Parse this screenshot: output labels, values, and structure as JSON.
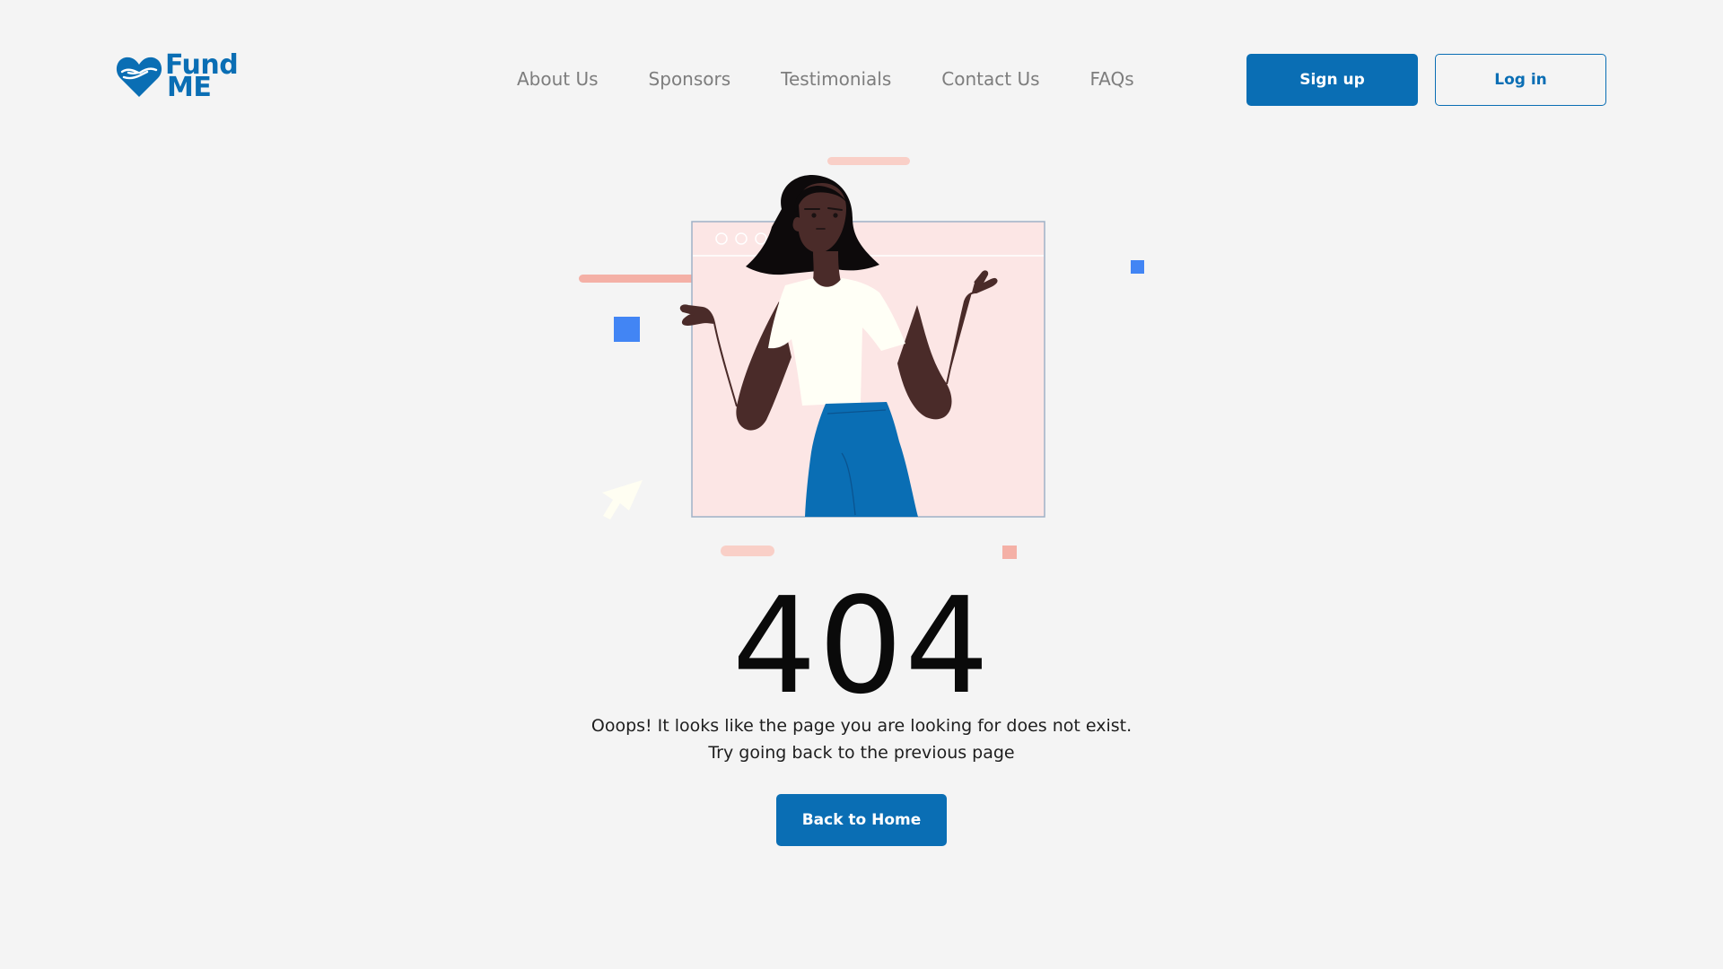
{
  "brand": {
    "name_line1": "Fund",
    "name_line2": "ME",
    "color": "#0a6eb4"
  },
  "nav": {
    "items": [
      {
        "label": "About Us"
      },
      {
        "label": "Sponsors"
      },
      {
        "label": "Testimonials"
      },
      {
        "label": "Contact Us"
      },
      {
        "label": "FAQs"
      }
    ]
  },
  "auth": {
    "signup_label": "Sign up",
    "login_label": "Log in"
  },
  "error": {
    "code": "404",
    "message_line1": "Ooops! It looks like the page you are looking for does not exist.",
    "message_line2": "Try going back to the previous page",
    "home_button_label": "Back to Home"
  },
  "illustration": {
    "icon": "shrugging-woman-illustration",
    "colors": {
      "frame_bg": "#fce6e5",
      "accent_pink": "#f4b0a6",
      "accent_blue": "#4285f4",
      "skin": "#4a2b29",
      "shirt": "#fffff6",
      "skirt": "#0a6eb4"
    }
  }
}
